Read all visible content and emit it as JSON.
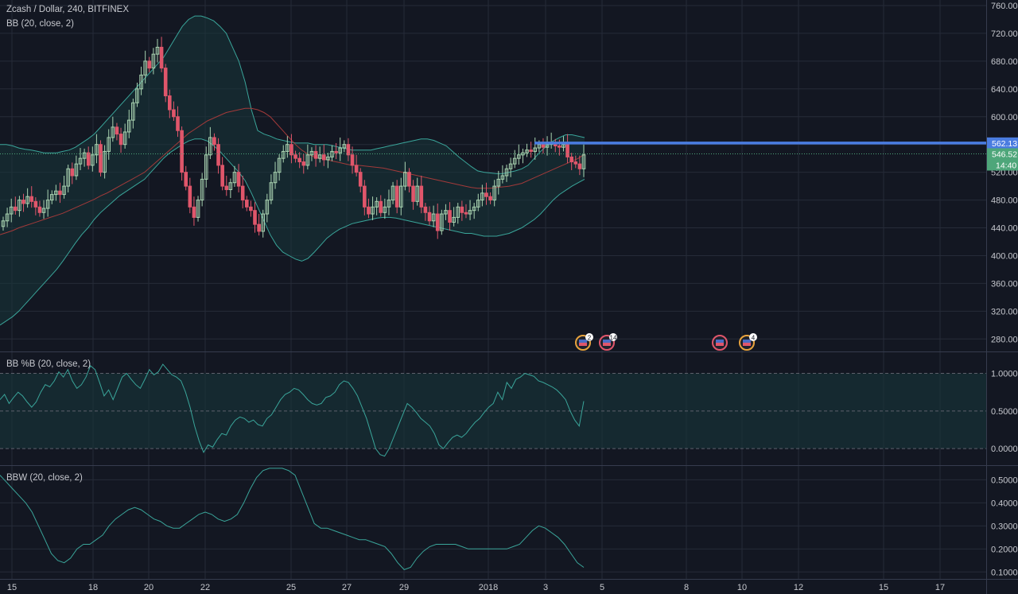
{
  "header": {
    "symbol_line": "Zcash / Dollar, 240, BITFINEX",
    "indicator_bb": "BB (20, close, 2)"
  },
  "panes": {
    "percent_b_title": "BB %B (20, close, 2)",
    "bbw_title": "BBW (20, close, 2)"
  },
  "colors": {
    "background": "#131722",
    "grid": "#262b38",
    "up": "#a9d3b1",
    "down": "#e0566b",
    "band": "#3aa59a",
    "band_fill": "#18363a",
    "basis": "#a33a3a",
    "resistance": "#4a7ce0",
    "last_price": "#4ea67a"
  },
  "chart_data": [
    {
      "type": "candlestick",
      "name": "price",
      "x_ticks": [
        "15",
        "18",
        "20",
        "22",
        "25",
        "27",
        "29",
        "2018",
        "3",
        "5",
        "8",
        "10",
        "12",
        "15",
        "17"
      ],
      "y_ticks": [
        "760.00",
        "720.00",
        "680.00",
        "640.00",
        "600.00",
        "560.00",
        "520.00",
        "480.00",
        "440.00",
        "400.00",
        "360.00",
        "320.00",
        "280.00"
      ],
      "ylim": [
        262,
        768
      ],
      "close": [
        450,
        460,
        470,
        465,
        480,
        475,
        485,
        478,
        470,
        462,
        468,
        480,
        488,
        493,
        488,
        500,
        525,
        515,
        532,
        540,
        548,
        530,
        545,
        560,
        520,
        550,
        570,
        585,
        575,
        560,
        578,
        595,
        620,
        640,
        660,
        680,
        670,
        690,
        700,
        670,
        630,
        610,
        600,
        580,
        520,
        500,
        470,
        455,
        480,
        510,
        545,
        570,
        560,
        530,
        500,
        495,
        505,
        520,
        500,
        480,
        470,
        465,
        445,
        435,
        460,
        480,
        505,
        520,
        540,
        550,
        560,
        545,
        540,
        535,
        530,
        545,
        550,
        540,
        545,
        538,
        542,
        550,
        548,
        555,
        560,
        545,
        530,
        520,
        500,
        470,
        460,
        470,
        478,
        462,
        470,
        480,
        500,
        470,
        500,
        520,
        500,
        478,
        500,
        470,
        462,
        450,
        460,
        436,
        460,
        465,
        448,
        455,
        470,
        462,
        460,
        465,
        470,
        480,
        490,
        485,
        480,
        500,
        510,
        515,
        525,
        532,
        540,
        545,
        548,
        552,
        550,
        555,
        560,
        556,
        560,
        562,
        558,
        556,
        560,
        542,
        535,
        532,
        525,
        545
      ],
      "upper_band": [
        560,
        560,
        558,
        555,
        553,
        552,
        550,
        548,
        548,
        548,
        550,
        552,
        556,
        562,
        568,
        575,
        585,
        595,
        605,
        615,
        625,
        635,
        645,
        655,
        665,
        675,
        685,
        700,
        715,
        730,
        740,
        745,
        745,
        742,
        738,
        730,
        720,
        700,
        680,
        650,
        610,
        580,
        575,
        572,
        568,
        566,
        564,
        562,
        562,
        562,
        560,
        560,
        560,
        558,
        556,
        554,
        552,
        552,
        552,
        552,
        554,
        556,
        558,
        560,
        562,
        564,
        566,
        568,
        568,
        566,
        562,
        558,
        550,
        542,
        535,
        528,
        522,
        520,
        519,
        518,
        518,
        520,
        522,
        525,
        530,
        540,
        550,
        558,
        565,
        570,
        574,
        574,
        572,
        570
      ],
      "basis": [
        430,
        433,
        436,
        440,
        443,
        446,
        449,
        452,
        455,
        458,
        461,
        465,
        469,
        473,
        477,
        481,
        486,
        490,
        495,
        500,
        505,
        510,
        515,
        520,
        528,
        536,
        544,
        552,
        560,
        568,
        576,
        582,
        588,
        594,
        598,
        602,
        606,
        608,
        610,
        612,
        612,
        610,
        606,
        600,
        590,
        580,
        570,
        560,
        552,
        546,
        542,
        540,
        538,
        536,
        534,
        532,
        530,
        530,
        529,
        528,
        527,
        526,
        524,
        522,
        520,
        518,
        516,
        514,
        512,
        510,
        508,
        506,
        504,
        502,
        500,
        498,
        497,
        497,
        497,
        498,
        499,
        500,
        502,
        504,
        508,
        512,
        516,
        520,
        524,
        528,
        532,
        536,
        540,
        546
      ],
      "lower_band": [
        300,
        306,
        312,
        320,
        330,
        340,
        350,
        360,
        370,
        380,
        392,
        405,
        418,
        430,
        440,
        452,
        462,
        470,
        478,
        486,
        492,
        498,
        504,
        510,
        520,
        530,
        540,
        548,
        554,
        560,
        565,
        568,
        568,
        565,
        558,
        550,
        540,
        530,
        520,
        508,
        490,
        470,
        450,
        430,
        415,
        405,
        400,
        395,
        392,
        396,
        405,
        415,
        425,
        432,
        438,
        442,
        446,
        448,
        450,
        452,
        454,
        455,
        455,
        454,
        452,
        450,
        448,
        446,
        444,
        442,
        440,
        438,
        436,
        434,
        432,
        432,
        430,
        428,
        428,
        428,
        430,
        432,
        436,
        440,
        446,
        452,
        460,
        470,
        480,
        488,
        494,
        500,
        505,
        510
      ],
      "resistance": 562.13,
      "last_price": 546.52,
      "price_labels": [
        "562.13",
        "546.52"
      ],
      "countdown": "14:40",
      "event_badges": [
        "2",
        "14",
        "",
        "4"
      ]
    },
    {
      "type": "line",
      "name": "BB %B",
      "y_ticks": [
        "1.0000",
        "0.5000",
        "0.0000"
      ],
      "ylim": [
        -0.22,
        1.28
      ],
      "values": [
        0.65,
        0.72,
        0.6,
        0.68,
        0.75,
        0.7,
        0.62,
        0.55,
        0.62,
        0.75,
        0.85,
        0.82,
        0.9,
        1.02,
        0.95,
        1.05,
        0.9,
        0.8,
        0.85,
        0.95,
        1.1,
        1.05,
        0.88,
        0.7,
        0.78,
        0.65,
        0.8,
        0.95,
        1.0,
        0.92,
        0.85,
        0.8,
        0.92,
        1.05,
        0.98,
        1.02,
        1.12,
        1.05,
        0.98,
        0.95,
        0.9,
        0.75,
        0.55,
        0.3,
        0.1,
        -0.05,
        0.05,
        0.02,
        0.12,
        0.2,
        0.18,
        0.3,
        0.38,
        0.42,
        0.4,
        0.35,
        0.38,
        0.32,
        0.3,
        0.4,
        0.45,
        0.55,
        0.65,
        0.72,
        0.75,
        0.8,
        0.78,
        0.72,
        0.65,
        0.6,
        0.58,
        0.6,
        0.68,
        0.7,
        0.75,
        0.85,
        0.9,
        0.88,
        0.8,
        0.7,
        0.55,
        0.4,
        0.2,
        0.0,
        -0.08,
        -0.1,
        0.0,
        0.15,
        0.3,
        0.45,
        0.6,
        0.55,
        0.48,
        0.4,
        0.35,
        0.3,
        0.2,
        0.05,
        0.0,
        0.08,
        0.15,
        0.18,
        0.15,
        0.2,
        0.28,
        0.35,
        0.4,
        0.48,
        0.55,
        0.6,
        0.75,
        0.65,
        0.88,
        0.8,
        0.92,
        0.95,
        1.0,
        0.98,
        0.96,
        0.9,
        0.88,
        0.85,
        0.82,
        0.78,
        0.72,
        0.65,
        0.5,
        0.38,
        0.3,
        0.63
      ],
      "extra_lines": [
        1.0,
        0.5,
        0.0
      ]
    },
    {
      "type": "line",
      "name": "BBW",
      "y_ticks": [
        "0.5000",
        "0.4000",
        "0.3000",
        "0.2000",
        "0.1000"
      ],
      "ylim": [
        0.07,
        0.56
      ],
      "values": [
        0.52,
        0.49,
        0.46,
        0.43,
        0.4,
        0.36,
        0.3,
        0.24,
        0.18,
        0.15,
        0.14,
        0.16,
        0.2,
        0.22,
        0.22,
        0.24,
        0.26,
        0.3,
        0.33,
        0.35,
        0.37,
        0.38,
        0.37,
        0.35,
        0.33,
        0.32,
        0.3,
        0.29,
        0.29,
        0.31,
        0.33,
        0.35,
        0.36,
        0.35,
        0.33,
        0.32,
        0.33,
        0.35,
        0.4,
        0.46,
        0.51,
        0.54,
        0.55,
        0.55,
        0.55,
        0.54,
        0.52,
        0.45,
        0.38,
        0.31,
        0.29,
        0.29,
        0.28,
        0.27,
        0.26,
        0.25,
        0.24,
        0.24,
        0.23,
        0.22,
        0.21,
        0.18,
        0.14,
        0.11,
        0.12,
        0.16,
        0.19,
        0.21,
        0.22,
        0.22,
        0.22,
        0.22,
        0.21,
        0.2,
        0.2,
        0.2,
        0.2,
        0.2,
        0.2,
        0.2,
        0.21,
        0.22,
        0.25,
        0.28,
        0.3,
        0.29,
        0.27,
        0.25,
        0.22,
        0.18,
        0.14,
        0.12
      ]
    }
  ]
}
